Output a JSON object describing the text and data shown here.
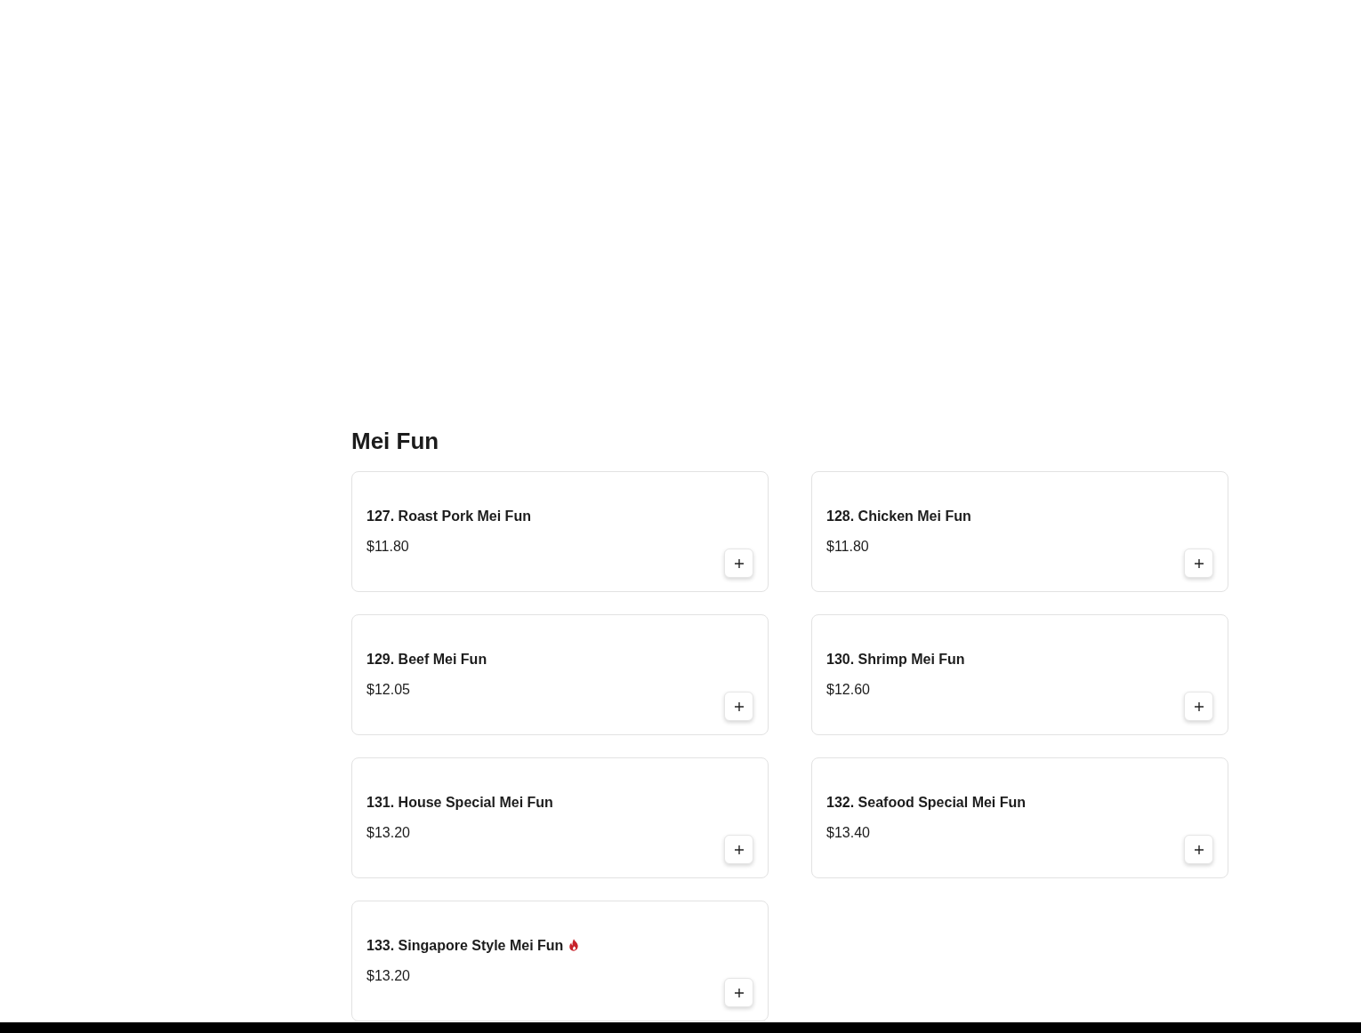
{
  "section": {
    "title": "Mei Fun",
    "items": [
      {
        "name": "127. Roast Pork Mei Fun",
        "price": "$11.80",
        "spicy": false
      },
      {
        "name": "128. Chicken Mei Fun",
        "price": "$11.80",
        "spicy": false
      },
      {
        "name": "129. Beef Mei Fun",
        "price": "$12.05",
        "spicy": false
      },
      {
        "name": "130. Shrimp Mei Fun",
        "price": "$12.60",
        "spicy": false
      },
      {
        "name": "131. House Special Mei Fun",
        "price": "$13.20",
        "spicy": false
      },
      {
        "name": "132. Seafood Special Mei Fun",
        "price": "$13.40",
        "spicy": false
      },
      {
        "name": "133. Singapore Style Mei Fun",
        "price": "$13.20",
        "spicy": true
      }
    ]
  }
}
